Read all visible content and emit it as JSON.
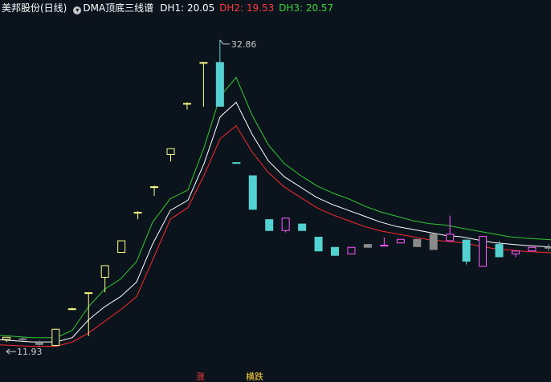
{
  "header": {
    "title": "美邦股份(日线)",
    "indicator": "DMA顶底三线谱",
    "dh1": "DH1: 20.05",
    "dh2": "DH2: 19.53",
    "dh3": "DH3: 20.57"
  },
  "chart_data": {
    "type": "candlestick",
    "y_range": [
      11.0,
      34.5
    ],
    "high_label": "32.86",
    "low_label": "11.93",
    "colors": {
      "up": "#ffff88",
      "down": "#54d2d2",
      "dh1": "#ffffff",
      "dh2": "#ff2a2a",
      "dh3": "#32c832",
      "magenta": "#ff55ff",
      "gray": "#8a8a8a"
    },
    "candles": [
      {
        "o": 12.35,
        "h": 12.55,
        "l": 12.2,
        "c": 12.55,
        "color": "up"
      },
      {
        "o": 12.45,
        "h": 12.5,
        "l": 12.3,
        "c": 12.35,
        "color": "gray"
      },
      {
        "o": 12.2,
        "h": 12.3,
        "l": 11.9,
        "c": 12.0,
        "color": "gray"
      },
      {
        "o": 11.93,
        "h": 13.1,
        "l": 11.93,
        "c": 13.1,
        "color": "up"
      },
      {
        "o": 14.5,
        "h": 14.55,
        "l": 14.4,
        "c": 14.45,
        "color": "up"
      },
      {
        "o": 15.6,
        "h": 15.6,
        "l": 12.6,
        "c": 15.6,
        "color": "up"
      },
      {
        "o": 16.6,
        "h": 16.6,
        "l": 15.6,
        "c": 17.45,
        "color": "up"
      },
      {
        "o": 18.3,
        "h": 19.15,
        "l": 18.3,
        "c": 19.15,
        "color": "up"
      },
      {
        "o": 21.1,
        "h": 21.15,
        "l": 20.6,
        "c": 21.1,
        "color": "up"
      },
      {
        "o": 22.85,
        "h": 22.9,
        "l": 22.2,
        "c": 22.85,
        "color": "up"
      },
      {
        "o": 25.0,
        "h": 25.45,
        "l": 24.55,
        "c": 25.45,
        "color": "up"
      },
      {
        "o": 28.55,
        "h": 28.6,
        "l": 28.1,
        "c": 28.55,
        "color": "up"
      },
      {
        "o": 31.35,
        "h": 31.35,
        "l": 28.3,
        "c": 31.35,
        "color": "up"
      },
      {
        "o": 31.35,
        "h": 32.86,
        "l": 28.3,
        "c": 28.3,
        "color": "down"
      },
      {
        "o": 24.5,
        "h": 24.5,
        "l": 24.4,
        "c": 24.4,
        "color": "down"
      },
      {
        "o": 23.6,
        "h": 23.6,
        "l": 21.25,
        "c": 21.25,
        "color": "down"
      },
      {
        "o": 20.6,
        "h": 20.6,
        "l": 19.8,
        "c": 19.8,
        "color": "down"
      },
      {
        "o": 19.8,
        "h": 20.7,
        "l": 19.7,
        "c": 20.7,
        "color": "magenta"
      },
      {
        "o": 20.3,
        "h": 20.3,
        "l": 19.8,
        "c": 19.8,
        "color": "down"
      },
      {
        "o": 19.4,
        "h": 19.4,
        "l": 18.4,
        "c": 18.4,
        "color": "down"
      },
      {
        "o": 18.7,
        "h": 18.7,
        "l": 18.1,
        "c": 18.1,
        "color": "down"
      },
      {
        "o": 18.2,
        "h": 18.7,
        "l": 18.2,
        "c": 18.7,
        "color": "magenta"
      },
      {
        "o": 18.65,
        "h": 18.9,
        "l": 18.65,
        "c": 18.9,
        "color": "gray"
      },
      {
        "o": 18.85,
        "h": 19.35,
        "l": 18.8,
        "c": 18.85,
        "color": "magenta"
      },
      {
        "o": 18.95,
        "h": 19.25,
        "l": 18.95,
        "c": 19.25,
        "color": "magenta"
      },
      {
        "o": 19.25,
        "h": 19.25,
        "l": 18.7,
        "c": 18.7,
        "color": "gray"
      },
      {
        "o": 18.5,
        "h": 19.6,
        "l": 18.5,
        "c": 19.6,
        "color": "gray"
      },
      {
        "o": 19.6,
        "h": 20.85,
        "l": 19.1,
        "c": 19.1,
        "color": "magenta"
      },
      {
        "o": 19.2,
        "h": 19.2,
        "l": 17.5,
        "c": 17.7,
        "color": "down"
      },
      {
        "o": 17.35,
        "h": 19.45,
        "l": 17.35,
        "c": 19.45,
        "color": "magenta"
      },
      {
        "o": 18.9,
        "h": 19.1,
        "l": 18.0,
        "c": 18.0,
        "color": "down"
      },
      {
        "o": 18.45,
        "h": 18.45,
        "l": 18.0,
        "c": 18.2,
        "color": "magenta"
      },
      {
        "o": 18.4,
        "h": 18.7,
        "l": 18.4,
        "c": 18.7,
        "color": "magenta"
      },
      {
        "o": 18.7,
        "h": 18.9,
        "l": 18.4,
        "c": 18.7,
        "color": "gray"
      }
    ],
    "dh3_line": [
      [
        0,
        12.65
      ],
      [
        40,
        12.5
      ],
      [
        70,
        12.5
      ],
      [
        90,
        13.0
      ],
      [
        110,
        14.6
      ],
      [
        130,
        15.8
      ],
      [
        150,
        16.5
      ],
      [
        170,
        17.7
      ],
      [
        190,
        20.4
      ],
      [
        212,
        22.0
      ],
      [
        234,
        22.6
      ],
      [
        254,
        25.5
      ],
      [
        274,
        29.0
      ],
      [
        294,
        30.3
      ],
      [
        314,
        27.7
      ],
      [
        334,
        25.7
      ],
      [
        354,
        24.4
      ],
      [
        374,
        23.6
      ],
      [
        394,
        22.9
      ],
      [
        414,
        22.4
      ],
      [
        434,
        22.0
      ],
      [
        454,
        21.5
      ],
      [
        474,
        21.1
      ],
      [
        494,
        20.8
      ],
      [
        514,
        20.5
      ],
      [
        534,
        20.3
      ],
      [
        554,
        20.2
      ],
      [
        574,
        20.0
      ],
      [
        594,
        19.8
      ],
      [
        614,
        19.6
      ],
      [
        634,
        19.4
      ],
      [
        654,
        19.3
      ],
      [
        686,
        19.2
      ]
    ],
    "dh1_line": [
      [
        0,
        12.35
      ],
      [
        40,
        12.2
      ],
      [
        70,
        12.2
      ],
      [
        90,
        12.5
      ],
      [
        110,
        13.7
      ],
      [
        130,
        14.6
      ],
      [
        150,
        15.3
      ],
      [
        170,
        16.3
      ],
      [
        190,
        18.9
      ],
      [
        212,
        21.2
      ],
      [
        234,
        21.9
      ],
      [
        254,
        24.4
      ],
      [
        274,
        27.6
      ],
      [
        294,
        28.6
      ],
      [
        314,
        26.4
      ],
      [
        334,
        24.6
      ],
      [
        354,
        23.5
      ],
      [
        374,
        22.8
      ],
      [
        394,
        22.1
      ],
      [
        414,
        21.6
      ],
      [
        434,
        21.2
      ],
      [
        454,
        20.8
      ],
      [
        474,
        20.4
      ],
      [
        494,
        20.1
      ],
      [
        514,
        19.9
      ],
      [
        534,
        19.7
      ],
      [
        554,
        19.5
      ],
      [
        574,
        19.4
      ],
      [
        594,
        19.2
      ],
      [
        614,
        19.0
      ],
      [
        634,
        18.9
      ],
      [
        654,
        18.8
      ],
      [
        686,
        18.7
      ]
    ],
    "dh2_line": [
      [
        0,
        12.0
      ],
      [
        40,
        11.9
      ],
      [
        70,
        11.9
      ],
      [
        90,
        12.2
      ],
      [
        110,
        12.8
      ],
      [
        130,
        13.6
      ],
      [
        150,
        14.4
      ],
      [
        170,
        15.3
      ],
      [
        190,
        17.8
      ],
      [
        212,
        20.6
      ],
      [
        234,
        21.4
      ],
      [
        254,
        23.6
      ],
      [
        274,
        26.1
      ],
      [
        294,
        27.0
      ],
      [
        314,
        25.2
      ],
      [
        334,
        23.8
      ],
      [
        354,
        22.8
      ],
      [
        374,
        22.1
      ],
      [
        394,
        21.4
      ],
      [
        414,
        20.9
      ],
      [
        434,
        20.5
      ],
      [
        454,
        20.1
      ],
      [
        474,
        19.8
      ],
      [
        494,
        19.6
      ],
      [
        514,
        19.4
      ],
      [
        534,
        19.2
      ],
      [
        554,
        19.1
      ],
      [
        574,
        19.0
      ],
      [
        594,
        18.8
      ],
      [
        614,
        18.6
      ],
      [
        634,
        18.5
      ],
      [
        654,
        18.4
      ],
      [
        686,
        18.3
      ]
    ]
  },
  "footer": {
    "up_label": "涨",
    "down_label": "横跌"
  }
}
